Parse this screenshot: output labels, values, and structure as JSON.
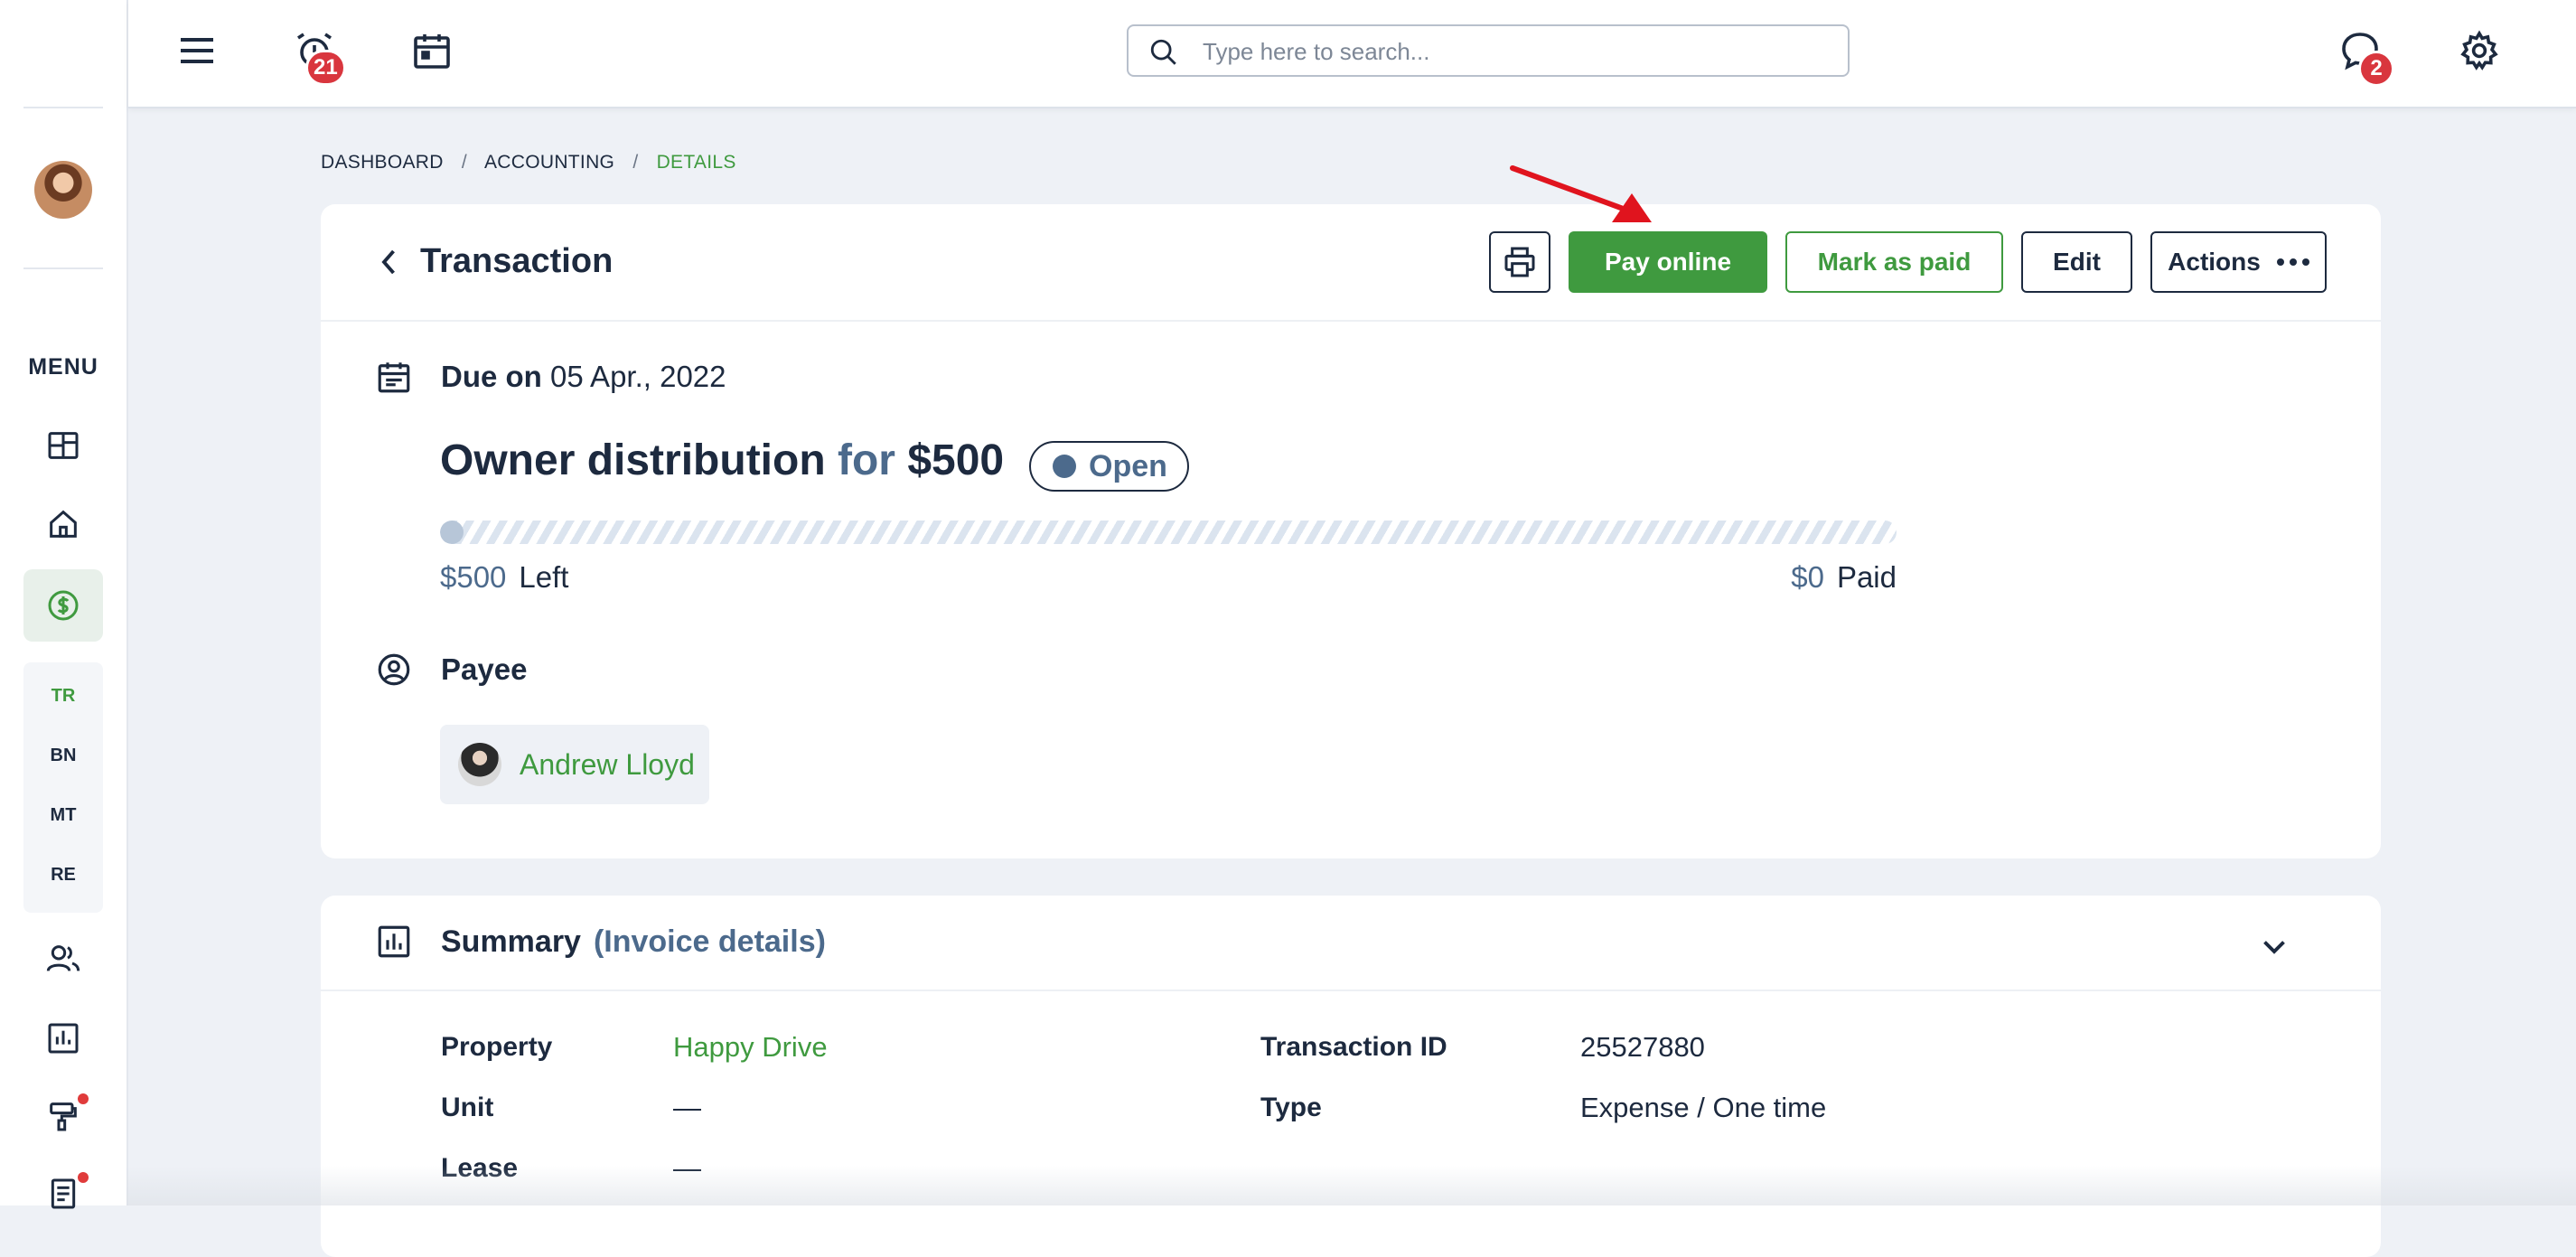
{
  "topbar": {
    "notifications_badge": "21",
    "messages_badge": "2",
    "search_placeholder": "Type here to search..."
  },
  "sidebar": {
    "menu_label": "MENU",
    "sub_items": [
      "TR",
      "BN",
      "MT",
      "RE"
    ]
  },
  "breadcrumb": [
    "DASHBOARD",
    "/",
    "ACCOUNTING",
    "/",
    "DETAILS"
  ],
  "transaction": {
    "title": "Transaction",
    "pay_online": "Pay online",
    "mark_as_paid": "Mark as paid",
    "edit": "Edit",
    "actions": "Actions",
    "due_label": "Due on",
    "due_date": "05 Apr., 2022",
    "headline_name": "Owner distribution",
    "headline_for": "for",
    "headline_amount": "$500",
    "status": "Open",
    "paid_fraction": 0.0,
    "left_amount": "$500",
    "left_label": "Left",
    "paid_amount": "$0",
    "paid_label": "Paid",
    "payee_label": "Payee",
    "payee_name": "Andrew Lloyd"
  },
  "summary": {
    "title": "Summary",
    "subtitle": "(Invoice details)",
    "fields": {
      "property_label": "Property",
      "property_value": "Happy Drive",
      "unit_label": "Unit",
      "unit_value": "—",
      "lease_label": "Lease",
      "lease_value": "—",
      "transaction_id_label": "Transaction ID",
      "transaction_id_value": "25527880",
      "type_label": "Type",
      "type_value": "Expense / One time"
    }
  },
  "colors": {
    "accent_green": "#3f9a3f",
    "navy": "#1d2a3f",
    "slate_blue": "#4c6a8c",
    "badge_red": "#d9363e",
    "annotation_arrow": "#e0141e"
  }
}
